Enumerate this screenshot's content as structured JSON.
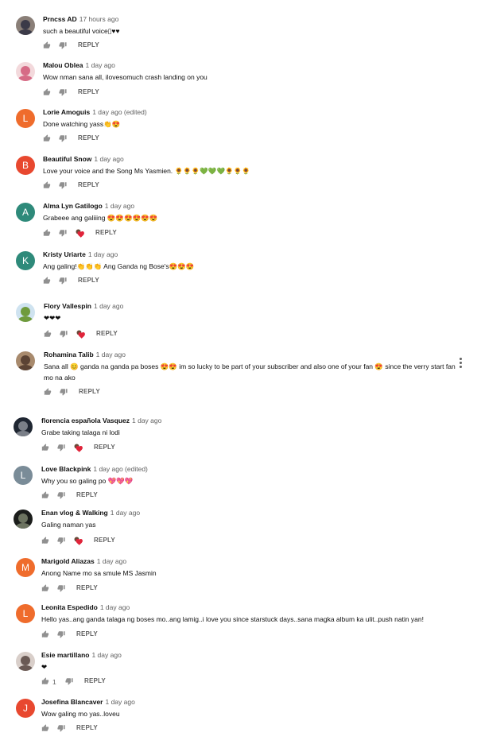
{
  "comments": [
    {
      "author": "Prncss AD",
      "time": "17 hours ago",
      "text": "such a beautiful voice▯♥♥",
      "reply": "REPLY",
      "avatar": {
        "type": "photo",
        "bg": "#8a7f78",
        "fg": "#3b3a48"
      },
      "heart": false,
      "likes": ""
    },
    {
      "author": "Malou Oblea",
      "time": "1 day ago",
      "text": "Wow nman sana all, ilovesomuch crash landing on you",
      "reply": "REPLY",
      "avatar": {
        "type": "photo",
        "bg": "#f3d9dc",
        "fg": "#d66b86"
      },
      "heart": false,
      "likes": ""
    },
    {
      "author": "Lorie Amoguis",
      "time": "1 day ago (edited)",
      "text": "Done watching yass👏😍",
      "reply": "REPLY",
      "avatar": {
        "type": "letter",
        "letter": "L",
        "bg": "#ef6c2c"
      },
      "heart": false,
      "likes": ""
    },
    {
      "author": "Beautiful Snow",
      "time": "1 day ago",
      "text": "Love your voice and the Song Ms Yasmien. 🌻🌻🌻💚💚💚🌻🌻🌻",
      "reply": "REPLY",
      "avatar": {
        "type": "letter",
        "letter": "B",
        "bg": "#e8482f"
      },
      "heart": false,
      "likes": ""
    },
    {
      "author": "Alma Lyn Gatilogo",
      "time": "1 day ago",
      "text": "Grabeee ang galiiing 😍😍😍😍😍😍",
      "reply": "REPLY",
      "avatar": {
        "type": "letter",
        "letter": "A",
        "bg": "#2e8a7a"
      },
      "heart": true,
      "likes": ""
    },
    {
      "author": "Kristy Uriarte",
      "time": "1 day ago",
      "text": "Ang galing!👏👏👏 Ang Ganda ng Bose's😍😍😍",
      "reply": "REPLY",
      "avatar": {
        "type": "letter",
        "letter": "K",
        "bg": "#2e8a7a"
      },
      "heart": false,
      "likes": ""
    },
    {
      "author": "Flory Vallespin",
      "time": "1 day ago",
      "text": "❤❤❤",
      "reply": "REPLY",
      "avatar": {
        "type": "photo",
        "bg": "#cfe3f0",
        "fg": "#6f9b3c"
      },
      "heart": true,
      "likes": ""
    },
    {
      "author": "Rohamina Talib",
      "time": "1 day ago",
      "text": "Sana all 😊 ganda na ganda pa boses 😍😍 im so lucky to be part of your subscriber and also one of your fan 😍 since the verry start fan mo na ako",
      "reply": "REPLY",
      "avatar": {
        "type": "photo",
        "bg": "#a88a6d",
        "fg": "#5b4334"
      },
      "heart": false,
      "likes": ""
    },
    {
      "author": "florencia española Vasquez",
      "time": "1 day ago",
      "text": "Grabe taking talaga ni lodi",
      "reply": "REPLY",
      "avatar": {
        "type": "photo",
        "bg": "#1f2632",
        "fg": "#7a7f88"
      },
      "heart": true,
      "likes": ""
    },
    {
      "author": "Love Blackpink",
      "time": "1 day ago (edited)",
      "text": "Why you so galing po 💖💖💖",
      "reply": "REPLY",
      "avatar": {
        "type": "letter",
        "letter": "L",
        "bg": "#7a8c98"
      },
      "heart": false,
      "likes": ""
    },
    {
      "author": "Enan vlog & Walking",
      "time": "1 day ago",
      "text": "Galing naman yas",
      "reply": "REPLY",
      "avatar": {
        "type": "photo",
        "bg": "#1b1d1b",
        "fg": "#6c7360"
      },
      "heart": true,
      "likes": ""
    },
    {
      "author": "Marigold Aliazas",
      "time": "1 day ago",
      "text": "Anong Name mo sa smule MS Jasmin",
      "reply": "REPLY",
      "avatar": {
        "type": "letter",
        "letter": "M",
        "bg": "#ef6c2c"
      },
      "heart": false,
      "likes": ""
    },
    {
      "author": "Leonita Espedido",
      "time": "1 day ago",
      "text": "Hello yas..ang ganda talaga ng boses mo..ang lamig..i love you since starstuck days..sana magka album ka ulit..push natin yan!",
      "reply": "REPLY",
      "avatar": {
        "type": "letter",
        "letter": "L",
        "bg": "#ef6c2c"
      },
      "heart": false,
      "likes": ""
    },
    {
      "author": "Esie martillano",
      "time": "1 day ago",
      "text": "❤",
      "reply": "REPLY",
      "avatar": {
        "type": "photo",
        "bg": "#d9cfca",
        "fg": "#6a5a55"
      },
      "heart": false,
      "likes": "1"
    },
    {
      "author": "Josefina Blancaver",
      "time": "1 day ago",
      "text": "Wow galing mo yas..loveu",
      "reply": "REPLY",
      "avatar": {
        "type": "letter",
        "letter": "J",
        "bg": "#e8482f"
      },
      "heart": false,
      "likes": ""
    }
  ]
}
